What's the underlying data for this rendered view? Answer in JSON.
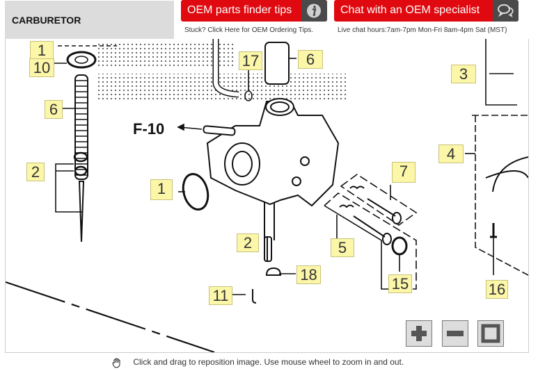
{
  "header": {
    "title": "CARBURETOR",
    "tips_button": {
      "label": "OEM parts finder tips",
      "icon": "info-icon",
      "subtext": "Stuck? Click Here for OEM Ordering Tips."
    },
    "chat_button": {
      "label": "Chat with an OEM specialist",
      "icon": "chat-bubbles-icon",
      "subtext": "Live chat hours:7am-7pm Mon-Fri 8am-4pm Sat (MST)"
    }
  },
  "diagram": {
    "reference_label": "F-10",
    "callouts": [
      {
        "id": "1-top",
        "label": "1"
      },
      {
        "id": "10",
        "label": "10"
      },
      {
        "id": "6-left",
        "label": "6"
      },
      {
        "id": "2-left",
        "label": "2"
      },
      {
        "id": "17",
        "label": "17"
      },
      {
        "id": "6-top",
        "label": "6"
      },
      {
        "id": "3",
        "label": "3"
      },
      {
        "id": "4",
        "label": "4"
      },
      {
        "id": "1-mid",
        "label": "1"
      },
      {
        "id": "7",
        "label": "7"
      },
      {
        "id": "5",
        "label": "5"
      },
      {
        "id": "2-mid",
        "label": "2"
      },
      {
        "id": "18",
        "label": "18"
      },
      {
        "id": "15",
        "label": "15"
      },
      {
        "id": "16",
        "label": "16"
      },
      {
        "id": "11",
        "label": "11"
      }
    ]
  },
  "controls": {
    "zoom_in": "zoom-in",
    "zoom_out": "zoom-out",
    "fit": "fit-to-view"
  },
  "footer": {
    "hint": "Click and drag to reposition image. Use mouse wheel to zoom in and out."
  }
}
